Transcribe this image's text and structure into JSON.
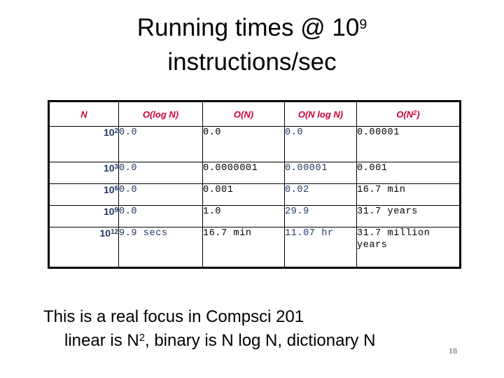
{
  "slide": {
    "title_main": "Running times @ 10",
    "title_exponent": "9",
    "title_line2": "instructions/sec",
    "number": "18"
  },
  "table": {
    "headers": [
      {
        "text": "N",
        "sup": ""
      },
      {
        "text": "O(log N)",
        "sup": ""
      },
      {
        "text": "O(N)",
        "sup": ""
      },
      {
        "text": "O(N log N)",
        "sup": ""
      },
      {
        "text": "O(N",
        "sup": "2"
      }
    ],
    "header_suffix": ")",
    "rows": [
      {
        "n_base": "10",
        "n_exp": "2",
        "log_n": "0.0",
        "n": "0.0",
        "n_log_n": "0.0",
        "n_squared": "0.00001"
      },
      {
        "n_base": "10",
        "n_exp": "3",
        "log_n": "0.0",
        "n": "0.0000001",
        "n_log_n": "0.00001",
        "n_squared": "0.001"
      },
      {
        "n_base": "10",
        "n_exp": "6",
        "log_n": "0.0",
        "n": "0.001",
        "n_log_n": "0.02",
        "n_squared": "16.7 min"
      },
      {
        "n_base": "10",
        "n_exp": "9",
        "log_n": "0.0",
        "n": "1.0",
        "n_log_n": "29.9",
        "n_squared": "31.7 years"
      },
      {
        "n_base": "10",
        "n_exp": "12",
        "log_n": "9.9 secs",
        "n": "16.7 min",
        "n_log_n": "11.07 hr",
        "n_squared": "31.7 million years"
      }
    ]
  },
  "notes": {
    "line1": "This is a real focus in Compsci 201",
    "line2_a": "linear is N",
    "line2_sup": "2",
    "line2_b": ", binary is N log N, dictionary N"
  },
  "colors": {
    "header_text": "#CC0033",
    "navy_text": "#1F3864",
    "black_text": "#000000",
    "border": "#000000",
    "background": "#FFFFFF"
  }
}
